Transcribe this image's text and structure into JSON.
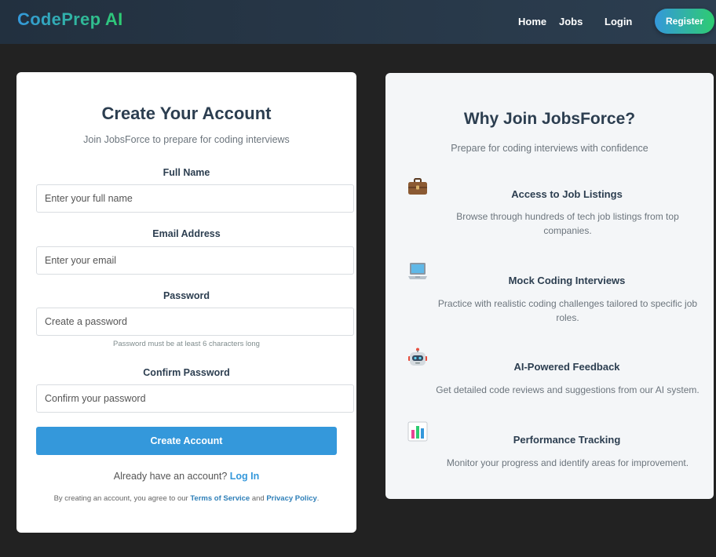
{
  "nav": {
    "brand": "CodePrep AI",
    "links": [
      "Home",
      "Jobs",
      "Login"
    ],
    "register": "Register"
  },
  "signup": {
    "title": "Create Your Account",
    "subtitle": "Join JobsForce to prepare for coding interviews",
    "full_name": {
      "label": "Full Name",
      "placeholder": "Enter your full name"
    },
    "email": {
      "label": "Email Address",
      "placeholder": "Enter your email"
    },
    "password": {
      "label": "Password",
      "placeholder": "Create a password",
      "hint": "Password must be at least 6 characters long"
    },
    "confirm": {
      "label": "Confirm Password",
      "placeholder": "Confirm your password"
    },
    "submit": "Create Account",
    "login_prompt": "Already have an account?",
    "login_link": "Log In",
    "terms_prefix": "By creating an account, you agree to our",
    "terms_link": "Terms of Service",
    "terms_and": "and",
    "privacy_link": "Privacy Policy",
    "terms_suffix": "."
  },
  "why": {
    "title": "Why Join JobsForce?",
    "subtitle": "Prepare for coding interviews with confidence",
    "features": [
      {
        "icon": "briefcase-icon",
        "title": "Access to Job Listings",
        "description": "Browse through hundreds of tech job listings from top companies."
      },
      {
        "icon": "laptop-icon",
        "title": "Mock Coding Interviews",
        "description": "Practice with realistic coding challenges tailored to specific job roles."
      },
      {
        "icon": "robot-icon",
        "title": "AI-Powered Feedback",
        "description": "Get detailed code reviews and suggestions from our AI system."
      },
      {
        "icon": "bar-chart-icon",
        "title": "Performance Tracking",
        "description": "Monitor your progress and identify areas for improvement."
      }
    ]
  },
  "colors": {
    "primary": "#3498db",
    "accent": "#2ecc71",
    "navbar": "#2c3e50",
    "page_background": "#222222"
  }
}
